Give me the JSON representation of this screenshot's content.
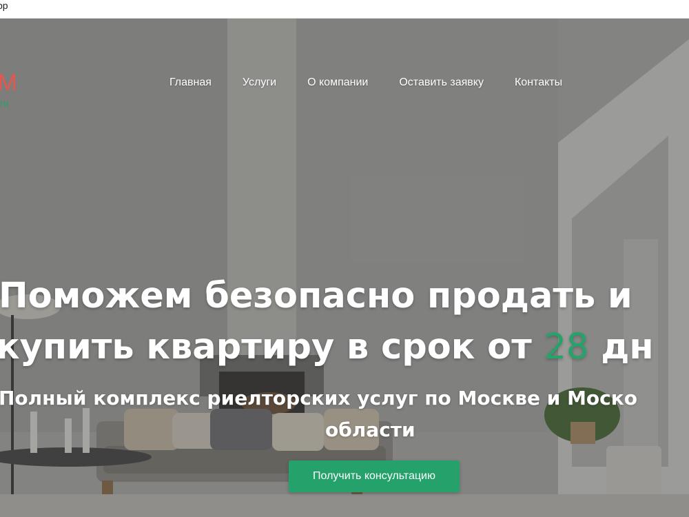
{
  "browser": {
    "url_fragment": "pp"
  },
  "logo": {
    "main": "УМ",
    "sub": "мости"
  },
  "nav": {
    "items": [
      {
        "label": "Главная"
      },
      {
        "label": "Услуги"
      },
      {
        "label": "О компании"
      },
      {
        "label": "Оставить заявку"
      },
      {
        "label": "Контакты"
      }
    ]
  },
  "hero": {
    "headline_line1": "Поможем безопасно продать и",
    "headline_line2_prefix": "купить квартиру в срок от ",
    "headline_accent": "28",
    "headline_line2_suffix": " дн",
    "subheadline_line1": "Полный комплекс риелторских услуг по Москве и Моско",
    "subheadline_line2": "области",
    "cta_label": "Получить консультацию"
  },
  "colors": {
    "accent_green": "#25a26c",
    "logo_red": "#e2584f"
  }
}
